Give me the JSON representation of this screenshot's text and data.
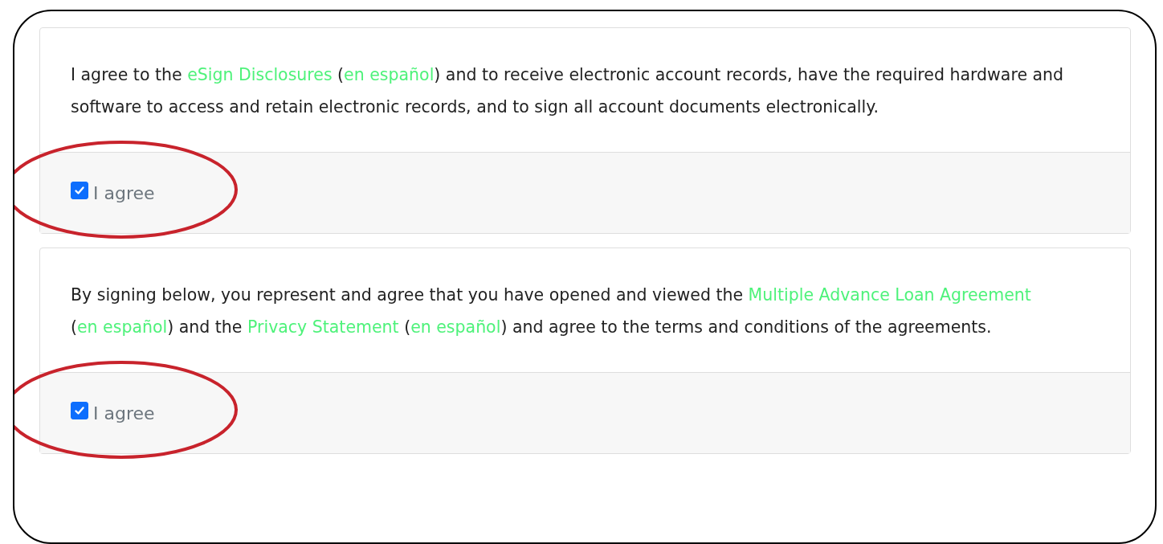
{
  "consents": [
    {
      "paragraph": [
        {
          "kind": "text",
          "text": "I agree to the "
        },
        {
          "kind": "link",
          "text": "eSign Disclosures"
        },
        {
          "kind": "text",
          "text": " ("
        },
        {
          "kind": "link",
          "text": "en español"
        },
        {
          "kind": "text",
          "text": ") and to receive electronic account records, have the required hardware and software to access and retain electronic records, and to sign all account documents electronically."
        }
      ],
      "checkbox": {
        "label": "I agree",
        "checked": true
      },
      "circled": true
    },
    {
      "paragraph": [
        {
          "kind": "text",
          "text": "By signing below, you represent and agree that you have opened and viewed the "
        },
        {
          "kind": "link",
          "text": "Multiple Advance Loan Agreement"
        },
        {
          "kind": "text",
          "text": " ("
        },
        {
          "kind": "link",
          "text": "en español"
        },
        {
          "kind": "text",
          "text": ") and the "
        },
        {
          "kind": "link",
          "text": "Privacy Statement"
        },
        {
          "kind": "text",
          "text": " ("
        },
        {
          "kind": "link",
          "text": "en español"
        },
        {
          "kind": "text",
          "text": ") and agree to the terms and conditions of the agreements."
        }
      ],
      "checkbox": {
        "label": "I agree",
        "checked": true
      },
      "circled": true
    }
  ]
}
